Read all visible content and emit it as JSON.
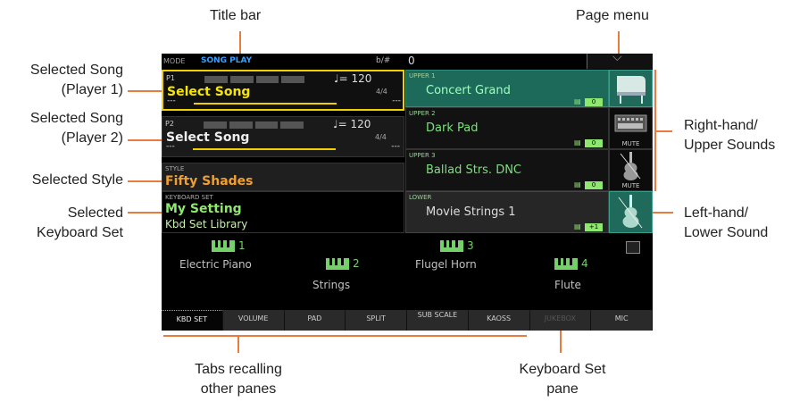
{
  "callouts": {
    "title_bar": "Title bar",
    "page_menu": "Page menu",
    "song1_a": "Selected Song",
    "song1_b": "(Player 1)",
    "song2_a": "Selected Song",
    "song2_b": "(Player 2)",
    "style": "Selected Style",
    "kbdset_a": "Selected",
    "kbdset_b": "Keyboard Set",
    "upper_a": "Right-hand/",
    "upper_b": "Upper Sounds",
    "lower_a": "Left-hand/",
    "lower_b": "Lower Sound",
    "tabs_a": "Tabs recalling",
    "tabs_b": "other panes",
    "pane_a": "Keyboard Set",
    "pane_b": "pane"
  },
  "title_bar": {
    "mode_label": "MODE",
    "mode_value": "SONG PLAY",
    "transpose_label": "b/#",
    "transpose_value": "0",
    "page_menu_icon": "chevron-down-icon"
  },
  "players": [
    {
      "label": "P1",
      "name": "Select Song",
      "tempo": "♩= 120",
      "meter": "4/4",
      "pos_start": "---",
      "pos_end": "---"
    },
    {
      "label": "P2",
      "name": "Select Song",
      "tempo": "♩= 120",
      "meter": "4/4",
      "pos_start": "---",
      "pos_end": "---"
    }
  ],
  "style": {
    "label": "STYLE",
    "name": "Fifty Shades"
  },
  "keyboard_set": {
    "label": "KEYBOARD SET",
    "name": "My Setting",
    "library": "Kbd Set Library"
  },
  "sounds": [
    {
      "label": "UPPER 1",
      "name": "Concert Grand",
      "octave": "0",
      "mute": "",
      "icon": "grand-piano-icon"
    },
    {
      "label": "UPPER 2",
      "name": "Dark Pad",
      "octave": "0",
      "mute": "MUTE",
      "icon": "synth-icon"
    },
    {
      "label": "UPPER 3",
      "name": "Ballad Strs. DNC",
      "octave": "0",
      "mute": "MUTE",
      "icon": "violin-icon"
    },
    {
      "label": "LOWER",
      "name": "Movie Strings 1",
      "octave": "+1",
      "mute": "",
      "icon": "violin-icon"
    }
  ],
  "kbd_pane": {
    "slots": [
      {
        "num": "1",
        "name": "Electric Piano"
      },
      {
        "num": "2",
        "name": "Strings"
      },
      {
        "num": "3",
        "name": "Flugel Horn"
      },
      {
        "num": "4",
        "name": "Flute"
      }
    ],
    "lock_icon": "lock-icon"
  },
  "tabs": [
    "KBD SET",
    "VOLUME",
    "PAD",
    "SPLIT",
    "SUB SCALE",
    "KAOSS",
    "JUKEBOX",
    "MIC"
  ],
  "colors": {
    "accent": "#e87c40",
    "selected_song": "#f0d000",
    "keyboard_set": "#8ee870"
  }
}
